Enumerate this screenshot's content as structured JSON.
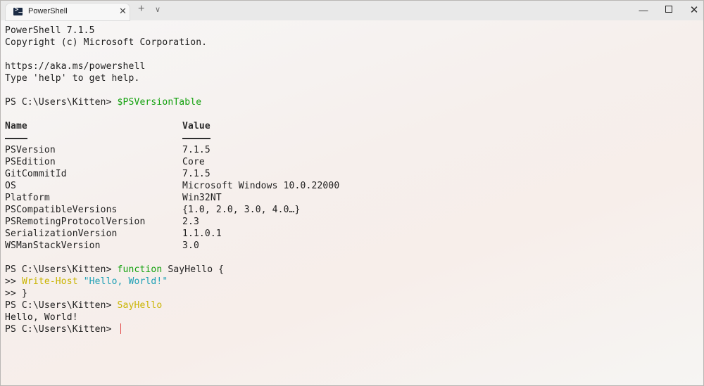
{
  "window": {
    "tab_title": "PowerShell",
    "tab_icon": "powershell-icon",
    "controls": {
      "new_tab": "+",
      "dropdown": "∨",
      "close_tab": "✕",
      "minimize": "—",
      "close": "✕"
    }
  },
  "terminal": {
    "banner": [
      "PowerShell 7.1.5",
      "Copyright (c) Microsoft Corporation.",
      "",
      "https://aka.ms/powershell",
      "Type 'help' to get help."
    ],
    "prompt": "PS C:\\Users\\Kitten> ",
    "cmd1": "$PSVersionTable",
    "table": {
      "headers": [
        "Name",
        "Value"
      ],
      "rows": [
        [
          "PSVersion",
          "7.1.5"
        ],
        [
          "PSEdition",
          "Core"
        ],
        [
          "GitCommitId",
          "7.1.5"
        ],
        [
          "OS",
          "Microsoft Windows 10.0.22000"
        ],
        [
          "Platform",
          "Win32NT"
        ],
        [
          "PSCompatibleVersions",
          "{1.0, 2.0, 3.0, 4.0…}"
        ],
        [
          "PSRemotingProtocolVersion",
          "2.3"
        ],
        [
          "SerializationVersion",
          "1.1.0.1"
        ],
        [
          "WSManStackVersion",
          "3.0"
        ]
      ]
    },
    "func": {
      "keyword": "function",
      "name": " SayHello {",
      "cont_prompt": ">> ",
      "body_cmd": "Write-Host",
      "body_str": " \"Hello, World!\"",
      "close": "}"
    },
    "cmd2": "SayHello",
    "output": "Hello, World!"
  },
  "colors": {
    "command": "#13a10e",
    "function_call": "#c9b400",
    "cursor": "#e24545"
  }
}
